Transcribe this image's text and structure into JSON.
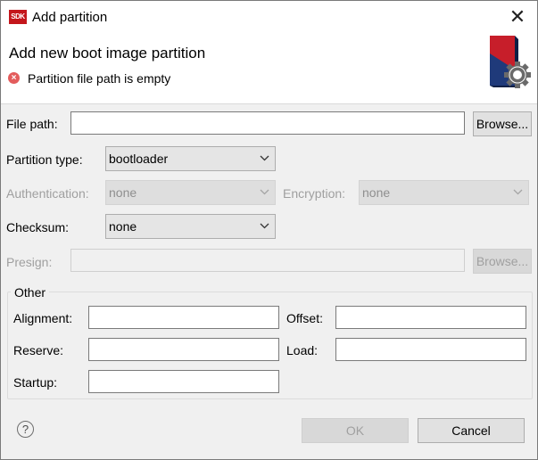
{
  "window": {
    "app_icon_text": "SDK",
    "title": "Add partition",
    "close_glyph": "✕"
  },
  "header": {
    "title": "Add new boot image partition",
    "error_message": "Partition file path is empty",
    "error_icon": "error-circle-icon",
    "banner_icon": "sdk-settings-icon"
  },
  "form": {
    "file_path": {
      "label": "File path:",
      "value": "",
      "browse_label": "Browse..."
    },
    "partition_type": {
      "label": "Partition type:",
      "value": "bootloader"
    },
    "authentication": {
      "label": "Authentication:",
      "value": "none",
      "enabled": false
    },
    "encryption": {
      "label": "Encryption:",
      "value": "none",
      "enabled": false
    },
    "checksum": {
      "label": "Checksum:",
      "value": "none"
    },
    "presign": {
      "label": "Presign:",
      "value": "",
      "browse_label": "Browse...",
      "enabled": false
    }
  },
  "other": {
    "group_label": "Other",
    "alignment": {
      "label": "Alignment:",
      "value": ""
    },
    "offset": {
      "label": "Offset:",
      "value": ""
    },
    "reserve": {
      "label": "Reserve:",
      "value": ""
    },
    "load": {
      "label": "Load:",
      "value": ""
    },
    "startup": {
      "label": "Startup:",
      "value": ""
    }
  },
  "footer": {
    "help_glyph": "?",
    "ok_label": "OK",
    "ok_enabled": false,
    "cancel_label": "Cancel"
  },
  "colors": {
    "error_red": "#e35c5c",
    "dialog_bg": "#f0f0f0",
    "header_bg": "#ffffff",
    "disabled_text": "#9f9f9f"
  }
}
